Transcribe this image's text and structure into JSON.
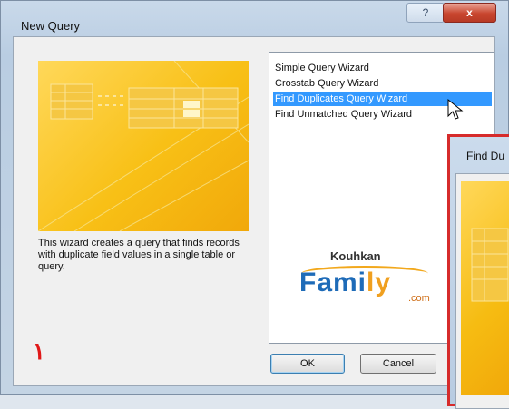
{
  "window": {
    "title": "New Query",
    "help_label": "?",
    "close_label": "x"
  },
  "description": "This wizard creates a query that finds records with duplicate field values in a single table or query.",
  "list": {
    "items": [
      {
        "label": "Simple Query Wizard",
        "selected": false
      },
      {
        "label": "Crosstab Query Wizard",
        "selected": false
      },
      {
        "label": "Find Duplicates Query Wizard",
        "selected": true
      },
      {
        "label": "Find Unmatched Query Wizard",
        "selected": false
      }
    ]
  },
  "watermark": {
    "top": "Kouhkan",
    "main_a": "Fami",
    "main_b": "ly",
    "suffix": ".com"
  },
  "marker": "۱",
  "buttons": {
    "ok": "OK",
    "cancel": "Cancel"
  },
  "second_window": {
    "title": "Find Du"
  },
  "colors": {
    "selection": "#3399ff",
    "preview": "#f8c016",
    "highlight_border": "#d62b2b"
  }
}
